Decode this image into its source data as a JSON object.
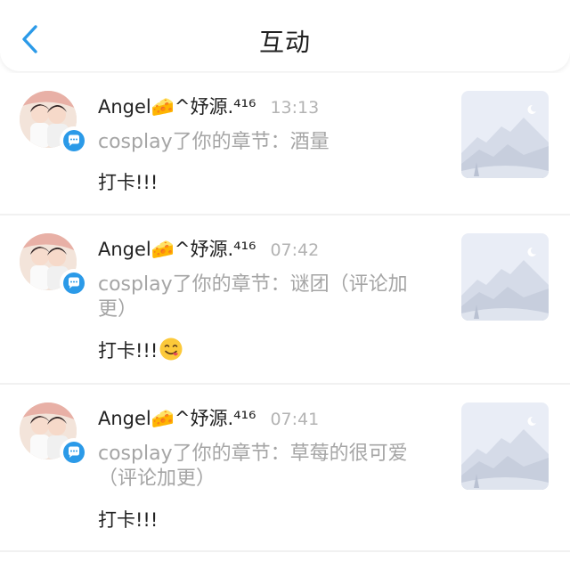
{
  "header": {
    "title": "互动"
  },
  "items": [
    {
      "name": "Angel🧀^妤源.⁴¹⁶",
      "time": "13:13",
      "desc": "cosplay了你的章节：酒量",
      "comment": "打卡!!!",
      "emoji": ""
    },
    {
      "name": "Angel🧀^妤源.⁴¹⁶",
      "time": "07:42",
      "desc": "cosplay了你的章节：谜团（评论加更）",
      "comment": "打卡!!!",
      "emoji": "savoring-food-emoji"
    },
    {
      "name": "Angel🧀^妤源.⁴¹⁶",
      "time": "07:41",
      "desc": "cosplay了你的章节：草莓的很可爱（评论加更）",
      "comment": "打卡!!!",
      "emoji": ""
    }
  ],
  "colors": {
    "accent_blue": "#2b9ae8",
    "text_dark": "#222222",
    "text_gray": "#a5a5a5",
    "time_gray": "#b3b3b3",
    "placeholder_bg": "#e9edf6"
  },
  "icons": {
    "back": "chevron-left-icon",
    "badge": "chat-bubble-icon",
    "thumb": "mountain-moon-placeholder-icon"
  }
}
